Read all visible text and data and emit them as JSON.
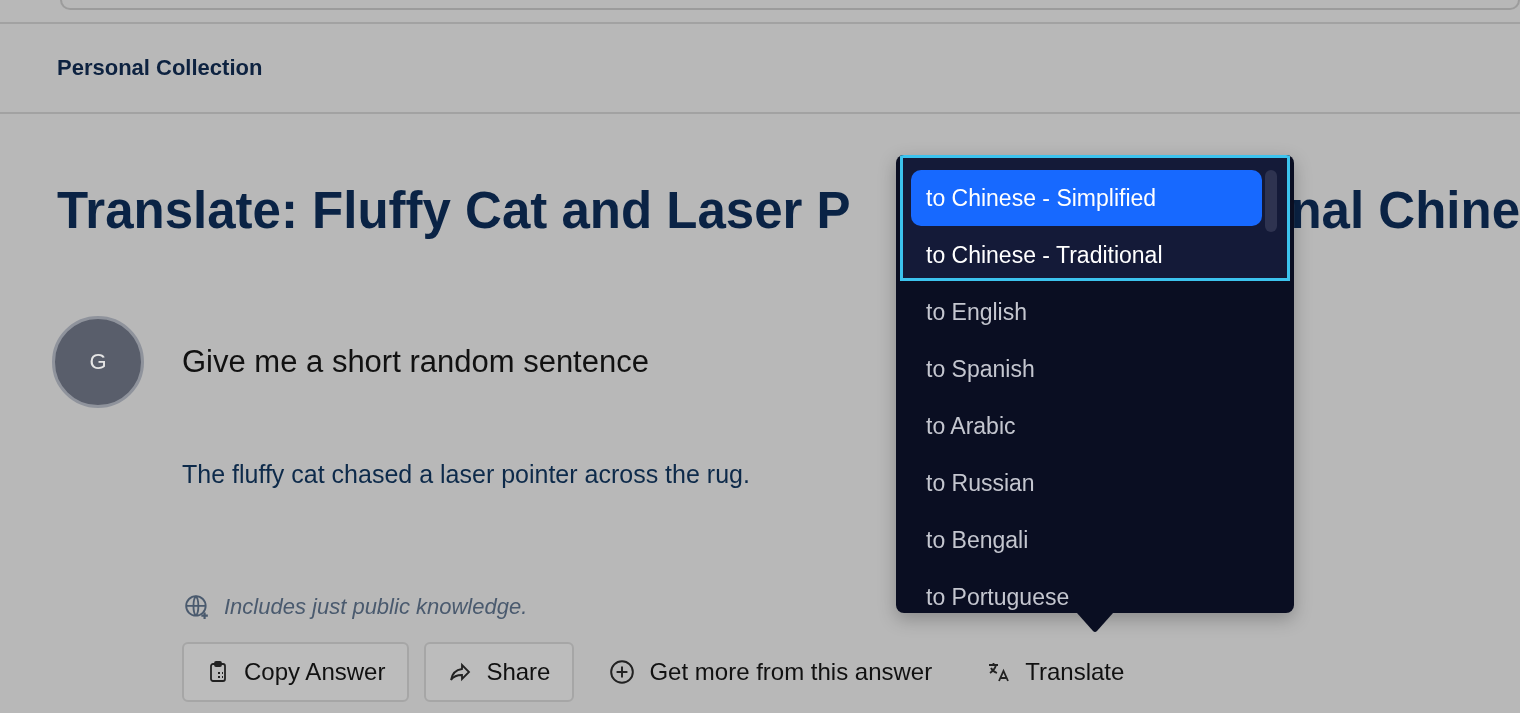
{
  "breadcrumb": "Personal Collection",
  "title_parts": [
    "Translate: Fluffy Cat and Laser P",
    "nal Chine"
  ],
  "question": {
    "avatar": "G",
    "text": "Give me a short random sentence"
  },
  "answer": "The fluffy cat chased a laser pointer across the rug.",
  "source_note": "Includes just public knowledge.",
  "actions": [
    {
      "label": "Copy Answer",
      "kind": "copy"
    },
    {
      "label": "Share",
      "kind": "share"
    },
    {
      "label": "Get more from this answer",
      "kind": "more"
    },
    {
      "label": "Translate",
      "kind": "translate"
    }
  ],
  "translate_menu": {
    "items": [
      {
        "label": "to Chinese - Simplified",
        "selected": true,
        "highlighted": true
      },
      {
        "label": "to Chinese - Traditional",
        "selected": false,
        "highlighted": true
      },
      {
        "label": "to English",
        "selected": false,
        "highlighted": false
      },
      {
        "label": "to Spanish",
        "selected": false,
        "highlighted": false
      },
      {
        "label": "to Arabic",
        "selected": false,
        "highlighted": false
      },
      {
        "label": "to Russian",
        "selected": false,
        "highlighted": false
      },
      {
        "label": "to Bengali",
        "selected": false,
        "highlighted": false
      },
      {
        "label": "to Portuguese",
        "selected": false,
        "highlighted": false
      }
    ]
  }
}
